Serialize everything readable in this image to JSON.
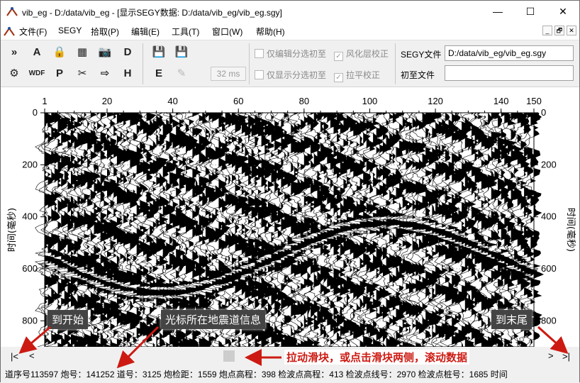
{
  "window": {
    "title": "vib_eg - D:/data/vib_eg - [显示SEGY数据: D:/data/vib_eg/vib_eg.sgy]",
    "minimize": "—",
    "maximize": "☐",
    "close": "✕"
  },
  "menu": {
    "items": [
      {
        "label": "文件(F)"
      },
      {
        "label": "SEGY"
      },
      {
        "label": "拾取(P)"
      },
      {
        "label": "编辑(E)"
      },
      {
        "label": "工具(T)"
      },
      {
        "label": "窗口(W)"
      },
      {
        "label": "帮助(H)"
      }
    ],
    "mdi": [
      "_",
      "🗗",
      "✕"
    ]
  },
  "toolbar": {
    "row1": [
      {
        "glyph": "»",
        "icon": "fast-forward-icon"
      },
      {
        "glyph": "A",
        "icon": "amplitude-icon"
      },
      {
        "glyph": "🔒",
        "icon": "lock-icon"
      },
      {
        "glyph": "▦",
        "icon": "table-icon"
      },
      {
        "glyph": "📷",
        "icon": "camera-icon"
      },
      {
        "glyph": "D",
        "icon": "display-icon"
      }
    ],
    "row2": [
      {
        "glyph": "⚙",
        "icon": "gear-icon"
      },
      {
        "glyph": "WDF",
        "icon": "wdf-icon"
      },
      {
        "glyph": "P",
        "icon": "pick-p-icon"
      },
      {
        "glyph": "✂",
        "icon": "cut-icon"
      },
      {
        "glyph": "⇨",
        "icon": "export-icon"
      },
      {
        "glyph": "H",
        "icon": "header-icon"
      }
    ],
    "save_glyph": "💾",
    "edit_glyph": "E",
    "pen_glyph": "✎",
    "ms_value": "32 ms",
    "check_only_edit": "仅编辑分选初至",
    "check_only_show": "仅显示分选初至",
    "check_weathering": "风化层校正",
    "check_flatten": "拉平校正",
    "segy_label": "SEGY文件",
    "segy_path": "D:/data/vib_eg/vib_eg.sgy",
    "first_break_label": "初至文件",
    "first_break_path": ""
  },
  "chart_data": {
    "type": "heatmap",
    "title": "",
    "xlabel": "",
    "ylabel": "时间(毫秒)",
    "x_ticks": [
      "1",
      "20",
      "40",
      "60",
      "80",
      "100",
      "120",
      "140",
      "150"
    ],
    "x_tick_values": [
      1,
      20,
      40,
      60,
      80,
      100,
      120,
      140,
      150
    ],
    "y_ticks": [
      "0",
      "200",
      "400",
      "600",
      "800"
    ],
    "y_tick_values": [
      0,
      200,
      400,
      600,
      800
    ],
    "xlim": [
      1,
      150
    ],
    "ylim": [
      0,
      900
    ],
    "y_reversed": true,
    "grid": true,
    "colors": {
      "fill": "#000000",
      "background": "#ffffff",
      "grid": "#bbbbbb"
    }
  },
  "scroll": {
    "start_glyph": "|<",
    "left_glyph": "<",
    "right_glyph": ">",
    "end_glyph": ">|"
  },
  "annotations": {
    "to_start": "到开始",
    "cursor_info": "光标所在地震道信息",
    "to_end": "到末尾",
    "drag_hint": "拉动滑块，或点击滑块两侧，滚动数据"
  },
  "status": {
    "text": "道序号113597  炮号：141252  道号：3125  炮检距：1559  炮点高程：398  检波点高程：413  检波点线号：2970  检波点桩号：1685  时间"
  }
}
